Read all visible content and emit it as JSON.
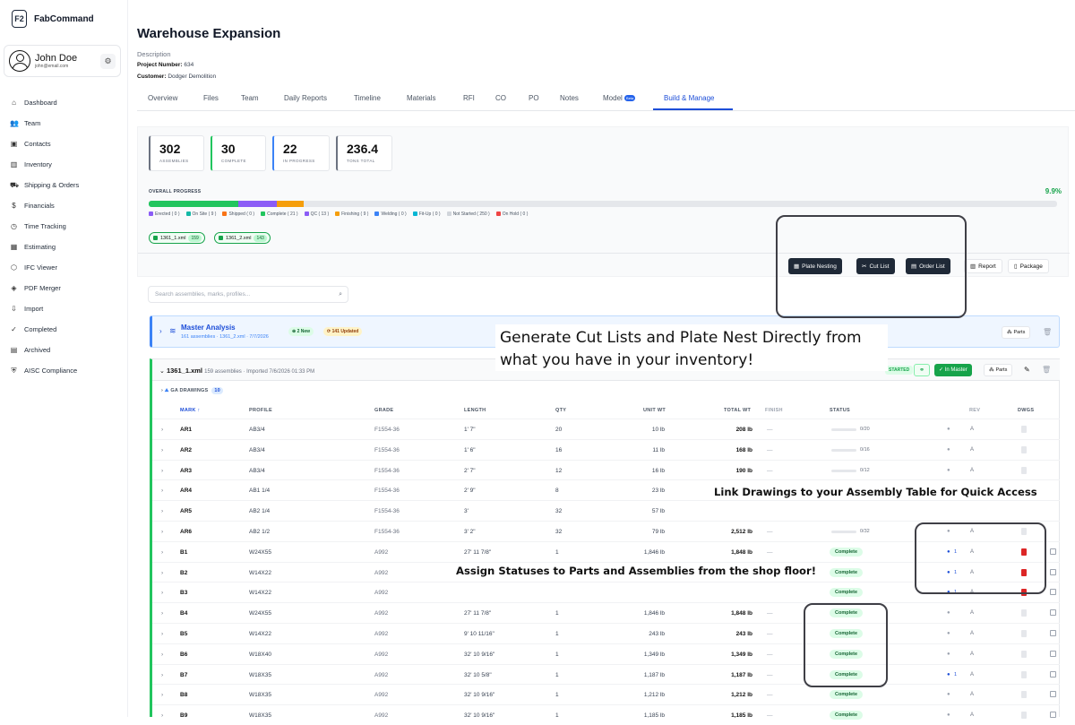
{
  "app": {
    "name": "FabCommand",
    "logo": "F2"
  },
  "user": {
    "name": "John Doe",
    "email": "john@email.com"
  },
  "nav": [
    {
      "label": "Dashboard",
      "icon": "home-icon"
    },
    {
      "label": "Team",
      "icon": "team-icon"
    },
    {
      "label": "Contacts",
      "icon": "contacts-icon"
    },
    {
      "label": "Inventory",
      "icon": "inventory-icon"
    },
    {
      "label": "Shipping & Orders",
      "icon": "truck-icon"
    },
    {
      "label": "Financials",
      "icon": "dollar-icon"
    },
    {
      "label": "Time Tracking",
      "icon": "clock-icon"
    },
    {
      "label": "Estimating",
      "icon": "calculator-icon"
    },
    {
      "label": "IFC Viewer",
      "icon": "cube-icon"
    },
    {
      "label": "PDF Merger",
      "icon": "layers-icon"
    },
    {
      "label": "Import",
      "icon": "import-icon"
    },
    {
      "label": "Completed",
      "icon": "check-icon"
    },
    {
      "label": "Archived",
      "icon": "archive-icon"
    },
    {
      "label": "AISC Compliance",
      "icon": "shield-icon"
    }
  ],
  "project": {
    "title": "Warehouse Expansion",
    "description_label": "Description",
    "number_label": "Project Number:",
    "number": "634",
    "customer_label": "Customer:",
    "customer": "Dodger Demolition"
  },
  "tabs": [
    "Overview",
    "Files",
    "Team",
    "Daily Reports",
    "Timeline",
    "Materials",
    "RFI",
    "CO",
    "PO",
    "Notes",
    "Model",
    "Build & Manage"
  ],
  "beta_label": "Beta",
  "stats": [
    {
      "value": "302",
      "label": "ASSEMBLIES",
      "color": "#6b7280"
    },
    {
      "value": "30",
      "label": "COMPLETE",
      "color": "#22c55e"
    },
    {
      "value": "22",
      "label": "IN PROGRESS",
      "color": "#3b82f6"
    },
    {
      "value": "236.4",
      "label": "TONS TOTAL",
      "color": "#6b7280"
    }
  ],
  "progress": {
    "label": "OVERALL PROGRESS",
    "percent_text": "9.9%",
    "segments": [
      {
        "fraction": 0.099,
        "color": "#22c55e"
      },
      {
        "fraction": 0.042,
        "color": "#8b5cf6"
      },
      {
        "fraction": 0.03,
        "color": "#f59e0b"
      }
    ],
    "legend": [
      {
        "text": "Erected ( 0 )",
        "color": "#8b5cf6"
      },
      {
        "text": "On Site ( 9 )",
        "color": "#14b8a6"
      },
      {
        "text": "Shipped ( 0 )",
        "color": "#f97316"
      },
      {
        "text": "Complete ( 21 )",
        "color": "#22c55e"
      },
      {
        "text": "QC ( 13 )",
        "color": "#8b5cf6"
      },
      {
        "text": "Finishing ( 9 )",
        "color": "#f59e0b"
      },
      {
        "text": "Welding ( 0 )",
        "color": "#3b82f6"
      },
      {
        "text": "Fit-Up ( 0 )",
        "color": "#06b6d4"
      },
      {
        "text": "Not Started ( 250 )",
        "color": "#d1d5db"
      },
      {
        "text": "On Hold ( 0 )",
        "color": "#ef4444"
      }
    ]
  },
  "files": [
    {
      "name": "1361_1.xml",
      "count": "159"
    },
    {
      "name": "1361_2.xml",
      "count": "143"
    }
  ],
  "actions": {
    "plate_nesting": "Plate Nesting",
    "cut_list": "Cut List",
    "order_list": "Order List",
    "report": "Report",
    "package": "Package"
  },
  "search_placeholder": "Search assemblies, marks, profiles...",
  "master": {
    "title": "Master Analysis",
    "subtitle": "161 assemblies · 1361_2.xml · 7/7/2026",
    "new_badge": "2 New",
    "updated_badge": "141 Updated",
    "parts": "Parts"
  },
  "file_section": {
    "name": "1361_1.xml",
    "meta": "159 assemblies · Imported 7/6/2026 01:33 PM",
    "started": "STARTED",
    "in_master": "In Master",
    "parts": "Parts",
    "ga_label": "GA DRAWINGS",
    "ga_count": "10"
  },
  "columns": [
    "MARK ↑",
    "PROFILE",
    "GRADE",
    "LENGTH",
    "QTY",
    "UNIT WT",
    "TOTAL WT",
    "FINISH",
    "STATUS",
    "REV",
    "DWGS"
  ],
  "rows": [
    {
      "mark": "AR1",
      "profile": "AB3/4",
      "grade": "F1554-36",
      "length": "1' 7\"",
      "qty": "20",
      "unit_wt": "10 lb",
      "total_wt": "208 lb",
      "finish": "—",
      "status_type": "progress",
      "status": "0/20",
      "rev": "A",
      "pdf": false,
      "comments": ""
    },
    {
      "mark": "AR2",
      "profile": "AB3/4",
      "grade": "F1554-36",
      "length": "1' 6\"",
      "qty": "16",
      "unit_wt": "11 lb",
      "total_wt": "168 lb",
      "finish": "—",
      "status_type": "progress",
      "status": "0/16",
      "rev": "A",
      "pdf": false,
      "comments": ""
    },
    {
      "mark": "AR3",
      "profile": "AB3/4",
      "grade": "F1554-36",
      "length": "2' 7\"",
      "qty": "12",
      "unit_wt": "16 lb",
      "total_wt": "190 lb",
      "finish": "—",
      "status_type": "progress",
      "status": "0/12",
      "rev": "A",
      "pdf": false,
      "comments": ""
    },
    {
      "mark": "AR4",
      "profile": "AB1 1/4",
      "grade": "F1554-36",
      "length": "2' 9\"",
      "qty": "8",
      "unit_wt": "23 lb",
      "total_wt": "",
      "finish": "",
      "status_type": "none",
      "status": "",
      "rev": "",
      "pdf": false,
      "comments": ""
    },
    {
      "mark": "AR5",
      "profile": "AB2 1/4",
      "grade": "F1554-36",
      "length": "3'",
      "qty": "32",
      "unit_wt": "57 lb",
      "total_wt": "",
      "finish": "",
      "status_type": "none",
      "status": "",
      "rev": "",
      "pdf": false,
      "comments": ""
    },
    {
      "mark": "AR6",
      "profile": "AB2 1/2",
      "grade": "F1554-36",
      "length": "3' 2\"",
      "qty": "32",
      "unit_wt": "79 lb",
      "total_wt": "2,512 lb",
      "finish": "—",
      "status_type": "progress",
      "status": "0/32",
      "rev": "A",
      "pdf": false,
      "comments": ""
    },
    {
      "mark": "B1",
      "profile": "W24X55",
      "grade": "A992",
      "length": "27' 11 7/8\"",
      "qty": "1",
      "unit_wt": "1,846 lb",
      "total_wt": "1,848 lb",
      "finish": "—",
      "status_type": "pill",
      "status": "Complete",
      "rev": "A",
      "pdf": true,
      "comments": "1"
    },
    {
      "mark": "B2",
      "profile": "W14X22",
      "grade": "A992",
      "length": "",
      "qty": "",
      "unit_wt": "",
      "total_wt": "",
      "finish": "",
      "status_type": "pill",
      "status": "Complete",
      "rev": "A",
      "pdf": true,
      "comments": "1"
    },
    {
      "mark": "B3",
      "profile": "W14X22",
      "grade": "A992",
      "length": "",
      "qty": "",
      "unit_wt": "",
      "total_wt": "",
      "finish": "",
      "status_type": "pill",
      "status": "Complete",
      "rev": "A",
      "pdf": true,
      "comments": "1"
    },
    {
      "mark": "B4",
      "profile": "W24X55",
      "grade": "A992",
      "length": "27' 11 7/8\"",
      "qty": "1",
      "unit_wt": "1,846 lb",
      "total_wt": "1,848 lb",
      "finish": "—",
      "status_type": "pill",
      "status": "Complete",
      "rev": "A",
      "pdf": false,
      "comments": ""
    },
    {
      "mark": "B5",
      "profile": "W14X22",
      "grade": "A992",
      "length": "9' 10 11/16\"",
      "qty": "1",
      "unit_wt": "243 lb",
      "total_wt": "243 lb",
      "finish": "—",
      "status_type": "pill",
      "status": "Complete",
      "rev": "A",
      "pdf": false,
      "comments": ""
    },
    {
      "mark": "B6",
      "profile": "W18X40",
      "grade": "A992",
      "length": "32' 10 9/16\"",
      "qty": "1",
      "unit_wt": "1,349 lb",
      "total_wt": "1,349 lb",
      "finish": "—",
      "status_type": "pill",
      "status": "Complete",
      "rev": "A",
      "pdf": false,
      "comments": ""
    },
    {
      "mark": "B7",
      "profile": "W18X35",
      "grade": "A992",
      "length": "32' 10 5/8\"",
      "qty": "1",
      "unit_wt": "1,187 lb",
      "total_wt": "1,187 lb",
      "finish": "—",
      "status_type": "pill",
      "status": "Complete",
      "rev": "A",
      "pdf": false,
      "comments": "1"
    },
    {
      "mark": "B8",
      "profile": "W18X35",
      "grade": "A992",
      "length": "32' 10 9/16\"",
      "qty": "1",
      "unit_wt": "1,212 lb",
      "total_wt": "1,212 lb",
      "finish": "—",
      "status_type": "pill",
      "status": "Complete",
      "rev": "A",
      "pdf": false,
      "comments": ""
    },
    {
      "mark": "B9",
      "profile": "W18X35",
      "grade": "A992",
      "length": "32' 10 9/16\"",
      "qty": "1",
      "unit_wt": "1,185 lb",
      "total_wt": "1,185 lb",
      "finish": "—",
      "status_type": "pill",
      "status": "Complete",
      "rev": "A",
      "pdf": false,
      "comments": ""
    }
  ],
  "callouts": {
    "cut_lists": "Generate Cut Lists and Plate Nest Directly from\nwhat you have in your inventory!",
    "drawings": "Link Drawings to your Assembly Table for Quick Access",
    "statuses": "Assign Statuses to Parts and Assemblies from the shop floor!"
  }
}
